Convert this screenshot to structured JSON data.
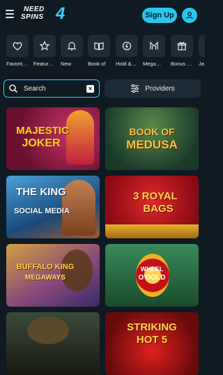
{
  "header": {
    "logo_top": "NEED",
    "logo_bottom": "SPINS",
    "logo_number": "4",
    "signup_label": "Sign Up"
  },
  "categories": [
    {
      "label": "Favorit…",
      "icon": "heart-icon"
    },
    {
      "label": "Featur…",
      "icon": "star-icon"
    },
    {
      "label": "New",
      "icon": "bell-icon"
    },
    {
      "label": "Book of",
      "icon": "book-icon"
    },
    {
      "label": "Hold &…",
      "icon": "coin-icon"
    },
    {
      "label": "Mega…",
      "icon": "mega-icon"
    },
    {
      "label": "Bonus …",
      "icon": "gift-icon"
    },
    {
      "label": "Ja",
      "icon": "jackpot-icon"
    }
  ],
  "search": {
    "label": "Search",
    "clear_icon": "close-icon"
  },
  "providers": {
    "label": "Providers",
    "icon": "sliders-icon"
  },
  "games": [
    {
      "line1": "MAJESTIC",
      "line2": "JOKER",
      "bg": "#7a1a3a"
    },
    {
      "line1": "BOOK OF",
      "line2": "MEDUSA",
      "bg": "#2a4a3a"
    },
    {
      "line1": "THE KING",
      "line2": "SOCIAL MEDIA",
      "bg": "#2e5d8c"
    },
    {
      "line1": "3 ROYAL",
      "line2": "BAGS",
      "bg": "#b0121e"
    },
    {
      "line1": "BUFFALO KING",
      "line2": "MEGAWAYS",
      "bg": "#7a4a8a"
    },
    {
      "line1": "WHEEL",
      "line2": "O'GOLD",
      "bg": "#1c5a3a"
    },
    {
      "line1": "",
      "line2": "",
      "bg": "#2a2a1a"
    },
    {
      "line1": "STRIKING",
      "line2": "HOT 5",
      "bg": "#a01010"
    }
  ],
  "colors": {
    "accent": "#28c7ef",
    "background": "#0f1a22",
    "panel": "#1e2c38"
  }
}
